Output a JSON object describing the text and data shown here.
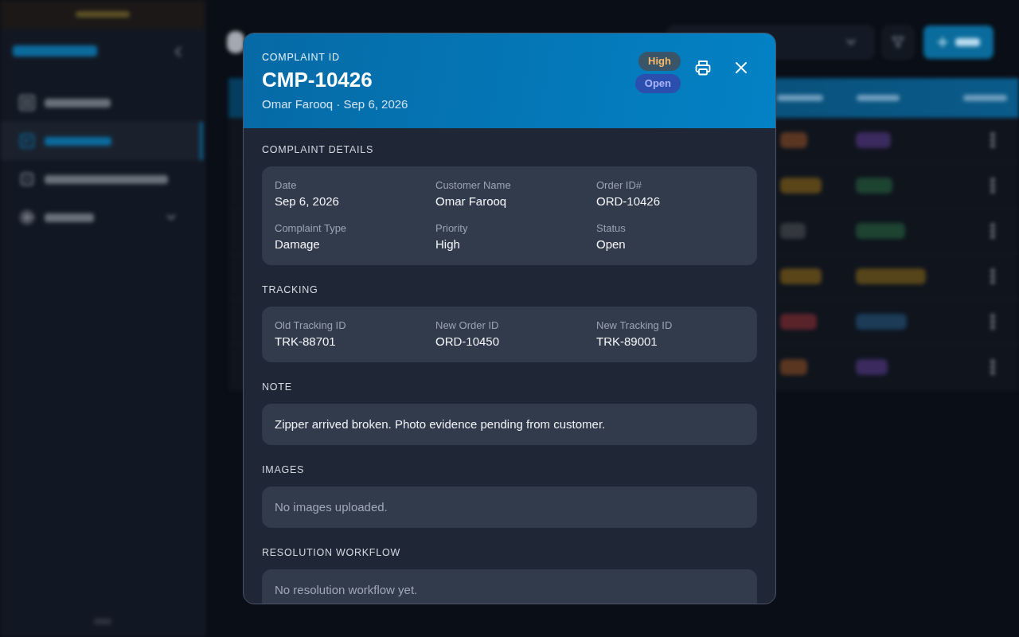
{
  "background": {
    "sidebar": {
      "items": [
        {
          "selected": false,
          "expandable": false
        },
        {
          "selected": true,
          "expandable": false
        },
        {
          "selected": false,
          "expandable": false
        },
        {
          "selected": false,
          "expandable": true
        }
      ]
    },
    "table": {
      "rows": [
        {
          "priority": {
            "color": "#5a3621"
          },
          "status": {
            "color": "#3a2a5e"
          }
        },
        {
          "priority": {
            "color": "#5a4519"
          },
          "status": {
            "color": "#1d4331"
          }
        },
        {
          "priority": {
            "color": "#34373e"
          },
          "status": {
            "color": "#1d4331"
          }
        },
        {
          "priority": {
            "color": "#5a4519"
          },
          "status": {
            "color": "#56441a"
          }
        },
        {
          "priority": {
            "color": "#5a2329"
          },
          "status": {
            "color": "#1b3b57"
          }
        },
        {
          "priority": {
            "color": "#5a3621"
          },
          "status": {
            "color": "#3a2a5e"
          }
        }
      ]
    }
  },
  "dialog": {
    "eyebrow": "COMPLAINT ID",
    "complaint_id": "CMP-10426",
    "subtitle": "Omar Farooq · Sep 6, 2026",
    "badges": [
      {
        "kind": "priority",
        "text": "High"
      },
      {
        "kind": "status",
        "text": "Open"
      }
    ],
    "sections": [
      {
        "title": "COMPLAINT DETAILS",
        "kind": "fields",
        "fields": [
          {
            "label": "Date",
            "value": "Sep 6, 2026"
          },
          {
            "label": "Customer Name",
            "value": "Omar Farooq"
          },
          {
            "label": "Order ID#",
            "value": "ORD-10426"
          },
          {
            "label": "Complaint Type",
            "value": "Damage"
          },
          {
            "label": "Priority",
            "value": "High"
          },
          {
            "label": "Status",
            "value": "Open"
          }
        ]
      },
      {
        "title": "TRACKING",
        "kind": "fields",
        "fields": [
          {
            "label": "Old Tracking ID",
            "value": "TRK-88701"
          },
          {
            "label": "New Order ID",
            "value": "ORD-10450"
          },
          {
            "label": "New Tracking ID",
            "value": "TRK-89001"
          }
        ]
      },
      {
        "title": "NOTE",
        "kind": "text",
        "text": "Zipper arrived broken. Photo evidence pending from customer."
      },
      {
        "title": "IMAGES",
        "kind": "empty",
        "text": "No images uploaded."
      },
      {
        "title": "RESOLUTION WORKFLOW",
        "kind": "empty",
        "text": "No resolution workflow yet."
      }
    ]
  }
}
